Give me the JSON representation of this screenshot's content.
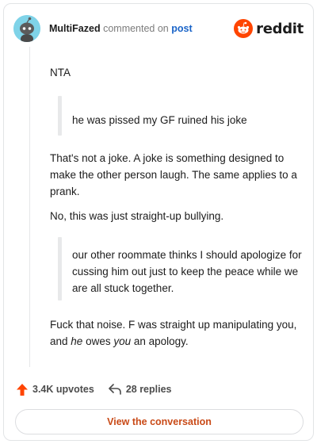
{
  "header": {
    "author": "MultiFazed",
    "action": "commented on",
    "link_label": "post",
    "brand": "reddit"
  },
  "comment": {
    "p1": "NTA",
    "quote1": "he was pissed my GF ruined his joke",
    "p2": "That's not a joke. A joke is something designed to make the other person laugh. The same applies to a prank.",
    "p3": "No, this was just straight-up bullying.",
    "quote2": "our other roommate thinks I should apologize for cussing him out just to keep the peace while we are all stuck together.",
    "p4_a": "Fuck that noise. F was straight up manipulating you, and ",
    "p4_em1": "he",
    "p4_b": " owes ",
    "p4_em2": "you",
    "p4_c": " an apology."
  },
  "footer": {
    "upvotes": "3.4K upvotes",
    "replies": "28 replies",
    "view_button": "View the conversation"
  },
  "colors": {
    "accent": "#ff4500",
    "link": "#1a64c8",
    "button_text": "#c94a17"
  },
  "icons": {
    "avatar": "snoo-avatar",
    "brand": "reddit-logo-icon",
    "upvote": "upvote-arrow-icon",
    "reply": "reply-arrow-icon"
  }
}
